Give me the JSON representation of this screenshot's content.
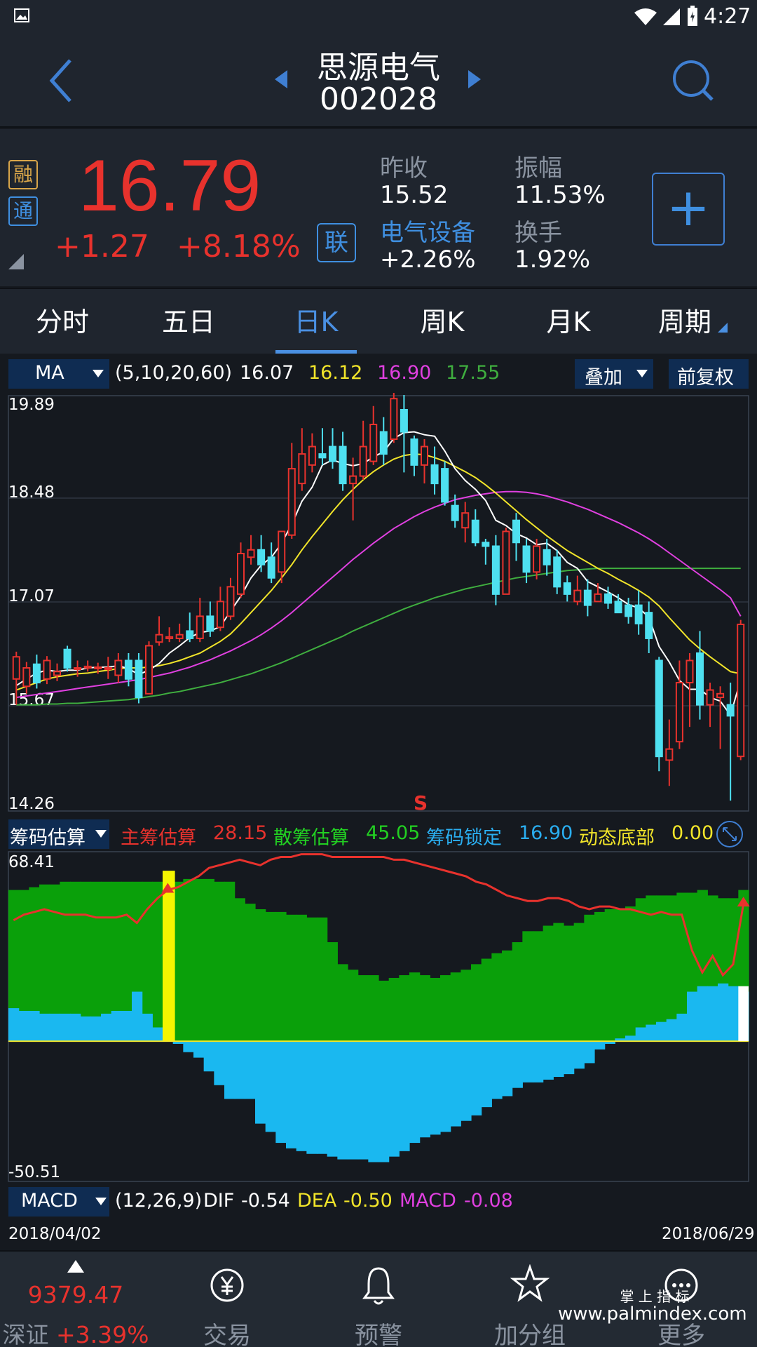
{
  "status": {
    "time": "4:27"
  },
  "header": {
    "name": "思源电气",
    "code": "002028"
  },
  "quote": {
    "badge_rong": "融",
    "badge_tong": "通",
    "price": "16.79",
    "change": "+1.27",
    "change_pct": "+8.18%",
    "link_label": "联",
    "prev_close_label": "昨收",
    "prev_close": "15.52",
    "amplitude_label": "振幅",
    "amplitude": "11.53%",
    "sector_label": "电气设备",
    "sector_change": "+2.26%",
    "turnover_label": "换手",
    "turnover": "1.92%",
    "add_label": "+"
  },
  "tabs": [
    "分时",
    "五日",
    "日K",
    "周K",
    "月K",
    "周期"
  ],
  "ma": {
    "selector": "MA",
    "params": "(5,10,20,60)",
    "v5": "16.07",
    "v10": "16.12",
    "v20": "16.90",
    "v60": "17.55",
    "overlay": "叠加",
    "fuquan": "前复权"
  },
  "price_axis": [
    "19.89",
    "18.48",
    "17.07",
    "15.67",
    "14.26"
  ],
  "sell_marker": "S",
  "chip": {
    "selector": "筹码估算",
    "main_label": "主筹估算",
    "main_value": "28.15",
    "retail_label": "散筹估算",
    "retail_value": "45.05",
    "lock_label": "筹码锁定",
    "lock_value": "16.90",
    "bottom_label": "动态底部",
    "bottom_value": "0.00",
    "axis_top": "68.41",
    "axis_bottom": "-50.51"
  },
  "macd": {
    "selector": "MACD",
    "params": "(12,26,9)",
    "dif_label": "DIF",
    "dif": "-0.54",
    "dea_label": "DEA",
    "dea": "-0.50",
    "macd_label": "MACD",
    "macd": "-0.08"
  },
  "dates": {
    "start": "2018/04/02",
    "end": "2018/06/29"
  },
  "index": {
    "value": "9379.47",
    "name": "深证",
    "change": "+3.39%"
  },
  "nav": [
    "交易",
    "预警",
    "加分组",
    "更多"
  ],
  "watermark": {
    "line1": "掌 上 指 标",
    "line2": "www.palmindex.com"
  },
  "colors": {
    "up": "#e8322d",
    "down": "#4ee0f0",
    "accent": "#4a90e2",
    "ma5": "#ffffff",
    "ma10": "#f2e52a",
    "ma20": "#e040e0",
    "ma60": "#3fae3f"
  },
  "chart_data": {
    "type": "candlestick",
    "ylim": [
      14.26,
      19.89
    ],
    "candles": [
      [
        16.05,
        16.35,
        16.42,
        15.7
      ],
      [
        15.95,
        16.2,
        16.28,
        15.85
      ],
      [
        16.25,
        16.0,
        16.38,
        15.92
      ],
      [
        16.05,
        16.3,
        16.36,
        15.98
      ],
      [
        16.1,
        16.15,
        16.26,
        16.02
      ],
      [
        16.45,
        16.2,
        16.5,
        16.15
      ],
      [
        16.2,
        16.2,
        16.3,
        16.08
      ],
      [
        16.2,
        16.22,
        16.3,
        16.15
      ],
      [
        16.2,
        16.21,
        16.27,
        16.12
      ],
      [
        16.2,
        16.2,
        16.35,
        16.05
      ],
      [
        16.1,
        16.3,
        16.4,
        16.0
      ],
      [
        16.3,
        16.05,
        16.4,
        15.95
      ],
      [
        16.3,
        15.8,
        16.4,
        15.72
      ],
      [
        15.85,
        16.5,
        16.56,
        15.85
      ],
      [
        16.55,
        16.65,
        16.9,
        16.5
      ],
      [
        16.6,
        16.62,
        16.75,
        16.55
      ],
      [
        16.6,
        16.65,
        16.8,
        16.55
      ],
      [
        16.7,
        16.6,
        16.95,
        16.55
      ],
      [
        16.6,
        16.9,
        17.15,
        16.55
      ],
      [
        16.9,
        16.7,
        17.1,
        16.62
      ],
      [
        16.75,
        17.1,
        17.3,
        16.7
      ],
      [
        16.9,
        17.3,
        17.42,
        16.85
      ],
      [
        17.2,
        17.75,
        17.9,
        17.15
      ],
      [
        17.7,
        17.8,
        18.0,
        17.6
      ],
      [
        17.8,
        17.6,
        18.0,
        17.5
      ],
      [
        17.7,
        17.42,
        17.9,
        17.35
      ],
      [
        17.5,
        18.05,
        18.05,
        17.35
      ],
      [
        18.0,
        18.9,
        19.25,
        17.95
      ],
      [
        18.7,
        19.1,
        19.45,
        18.6
      ],
      [
        18.95,
        19.2,
        19.38,
        18.85
      ],
      [
        19.1,
        19.05,
        19.45,
        18.95
      ],
      [
        19.2,
        19.0,
        19.45,
        18.9
      ],
      [
        19.2,
        18.7,
        19.4,
        18.6
      ],
      [
        18.7,
        18.8,
        19.05,
        18.2
      ],
      [
        18.8,
        19.2,
        19.55,
        18.75
      ],
      [
        19.0,
        19.5,
        19.75,
        18.95
      ],
      [
        19.4,
        19.1,
        19.6,
        18.95
      ],
      [
        19.3,
        19.85,
        19.95,
        19.25
      ],
      [
        19.7,
        19.4,
        19.9,
        18.85
      ],
      [
        19.3,
        18.95,
        19.35,
        18.8
      ],
      [
        18.95,
        19.2,
        19.3,
        18.7
      ],
      [
        18.95,
        18.7,
        19.2,
        18.55
      ],
      [
        18.9,
        18.45,
        19.0,
        18.4
      ],
      [
        18.4,
        18.2,
        18.55,
        18.1
      ],
      [
        18.1,
        18.3,
        18.45,
        17.9
      ],
      [
        18.2,
        17.9,
        18.35,
        17.85
      ],
      [
        17.9,
        17.85,
        17.95,
        17.6
      ],
      [
        17.85,
        17.2,
        18.0,
        17.05
      ],
      [
        17.2,
        18.05,
        18.1,
        17.2
      ],
      [
        18.2,
        17.9,
        18.3,
        17.65
      ],
      [
        17.85,
        17.5,
        17.95,
        17.35
      ],
      [
        17.5,
        17.85,
        17.95,
        17.4
      ],
      [
        17.8,
        17.6,
        17.95,
        17.45
      ],
      [
        17.7,
        17.3,
        17.8,
        17.2
      ],
      [
        17.35,
        17.2,
        17.45,
        17.1
      ],
      [
        17.1,
        17.25,
        17.45,
        17.05
      ],
      [
        17.25,
        17.05,
        17.4,
        16.9
      ],
      [
        17.1,
        17.2,
        17.35,
        17.1
      ],
      [
        17.2,
        17.08,
        17.3,
        17.0
      ],
      [
        17.1,
        16.95,
        17.2,
        16.95
      ],
      [
        17.05,
        16.9,
        17.15,
        16.8
      ],
      [
        17.05,
        16.8,
        17.25,
        16.65
      ],
      [
        16.95,
        16.6,
        17.1,
        16.4
      ],
      [
        16.3,
        15.0,
        16.35,
        14.8
      ],
      [
        14.95,
        15.1,
        15.5,
        14.6
      ],
      [
        15.2,
        16.0,
        16.3,
        15.1
      ],
      [
        16.0,
        16.3,
        16.4,
        15.4
      ],
      [
        16.4,
        15.7,
        16.7,
        15.5
      ],
      [
        15.7,
        15.9,
        16.0,
        15.4
      ],
      [
        15.8,
        15.85,
        15.95,
        15.1
      ],
      [
        15.7,
        15.55,
        16.0,
        14.4
      ],
      [
        15.0,
        16.79,
        16.85,
        14.95
      ]
    ],
    "ma5": [
      15.96,
      16.05,
      16.13,
      16.17,
      16.15,
      16.17,
      16.17,
      16.2,
      16.21,
      16.21,
      16.23,
      16.19,
      16.11,
      16.17,
      16.26,
      16.4,
      16.5,
      16.61,
      16.68,
      16.7,
      16.76,
      16.97,
      17.17,
      17.42,
      17.59,
      17.7,
      17.89,
      18.15,
      18.46,
      18.65,
      18.95,
      19.02,
      18.97,
      18.94,
      18.97,
      19.06,
      19.13,
      19.31,
      19.39,
      19.4,
      19.36,
      19.34,
      19.14,
      18.9,
      18.74,
      18.62,
      18.47,
      18.2,
      18.13,
      18.02,
      17.96,
      17.87,
      17.89,
      17.79,
      17.63,
      17.55,
      17.37,
      17.3,
      17.23,
      17.15,
      17.06,
      17.01,
      16.89,
      16.49,
      16.28,
      16.03,
      15.91,
      15.91,
      15.8,
      15.75,
      15.56,
      16.04
    ],
    "ma10": [
      15.9,
      15.95,
      16.0,
      16.05,
      16.08,
      16.1,
      16.12,
      16.13,
      16.15,
      16.17,
      16.19,
      16.2,
      16.2,
      16.21,
      16.23,
      16.26,
      16.3,
      16.35,
      16.4,
      16.48,
      16.56,
      16.66,
      16.8,
      16.95,
      17.1,
      17.25,
      17.42,
      17.6,
      17.8,
      17.98,
      18.15,
      18.32,
      18.48,
      18.62,
      18.75,
      18.86,
      18.95,
      19.03,
      19.08,
      19.1,
      19.09,
      19.05,
      19.0,
      18.93,
      18.86,
      18.78,
      18.68,
      18.57,
      18.45,
      18.33,
      18.21,
      18.1,
      17.99,
      17.89,
      17.79,
      17.71,
      17.63,
      17.55,
      17.48,
      17.4,
      17.33,
      17.25,
      17.16,
      17.04,
      16.88,
      16.73,
      16.58,
      16.46,
      16.35,
      16.25,
      16.15,
      16.12
    ],
    "ma20": [
      15.8,
      15.82,
      15.84,
      15.86,
      15.88,
      15.9,
      15.92,
      15.94,
      15.96,
      15.98,
      16.0,
      16.02,
      16.04,
      16.07,
      16.1,
      16.13,
      16.17,
      16.21,
      16.26,
      16.31,
      16.37,
      16.43,
      16.5,
      16.57,
      16.65,
      16.74,
      16.84,
      16.95,
      17.07,
      17.19,
      17.31,
      17.43,
      17.55,
      17.67,
      17.78,
      17.89,
      17.99,
      18.09,
      18.17,
      18.25,
      18.32,
      18.38,
      18.43,
      18.48,
      18.51,
      18.54,
      18.56,
      18.58,
      18.59,
      18.59,
      18.58,
      18.56,
      18.53,
      18.49,
      18.45,
      18.4,
      18.35,
      18.29,
      18.23,
      18.17,
      18.1,
      18.03,
      17.95,
      17.86,
      17.76,
      17.66,
      17.56,
      17.46,
      17.36,
      17.26,
      17.15,
      16.9
    ],
    "ma60": [
      15.7,
      15.7,
      15.7,
      15.71,
      15.71,
      15.72,
      15.72,
      15.73,
      15.74,
      15.75,
      15.76,
      15.77,
      15.79,
      15.81,
      15.83,
      15.86,
      15.88,
      15.91,
      15.94,
      15.97,
      16.0,
      16.04,
      16.08,
      16.12,
      16.17,
      16.22,
      16.27,
      16.33,
      16.39,
      16.45,
      16.51,
      16.57,
      16.63,
      16.7,
      16.76,
      16.82,
      16.88,
      16.94,
      17.0,
      17.05,
      17.1,
      17.15,
      17.19,
      17.23,
      17.27,
      17.3,
      17.33,
      17.36,
      17.39,
      17.42,
      17.44,
      17.46,
      17.48,
      17.5,
      17.52,
      17.53,
      17.54,
      17.55,
      17.55,
      17.55,
      17.55,
      17.55,
      17.55,
      17.55,
      17.55,
      17.55,
      17.55,
      17.55,
      17.55,
      17.55,
      17.55,
      17.55
    ],
    "chip_retail": [
      55,
      55,
      56,
      57,
      57,
      58,
      58,
      58,
      58,
      58,
      58,
      58,
      58,
      58,
      58,
      58,
      58,
      59,
      59,
      59,
      58,
      58,
      52,
      50,
      48,
      47,
      47,
      46,
      46,
      45,
      45,
      36,
      28,
      26,
      24,
      24,
      22,
      23,
      24,
      25,
      24,
      23,
      24,
      25,
      26,
      28,
      30,
      32,
      33,
      36,
      40,
      40,
      42,
      43,
      42,
      43,
      46,
      47,
      48,
      48,
      49,
      52,
      53,
      53,
      53,
      54,
      54,
      55,
      53,
      52,
      52,
      55
    ],
    "chip_main": [
      44,
      46,
      47,
      48,
      47,
      46,
      46,
      46,
      45,
      45,
      45,
      46,
      43,
      48,
      52,
      55,
      56,
      58,
      60,
      63,
      64,
      65,
      66,
      65,
      64,
      66,
      67,
      67,
      68,
      68,
      68,
      67,
      67,
      67,
      67,
      67,
      67,
      66,
      66,
      65,
      64,
      63,
      62,
      61,
      60,
      58,
      57,
      55,
      53,
      52,
      51,
      51,
      52,
      52,
      51,
      49,
      48,
      49,
      49,
      48,
      48,
      47,
      46,
      47,
      46,
      46,
      33,
      25,
      31,
      24,
      28,
      50
    ],
    "chip_lock": [
      12,
      11,
      11,
      10,
      10,
      10,
      10,
      9,
      9,
      10,
      11,
      11,
      18,
      10,
      5,
      0,
      0,
      0,
      0,
      0,
      0,
      0,
      0,
      0,
      0,
      0,
      0,
      0,
      0,
      0,
      0,
      0,
      0,
      0,
      0,
      0,
      0,
      0,
      0,
      0,
      0,
      0,
      0,
      0,
      0,
      0,
      0,
      0,
      0,
      0,
      0,
      0,
      0,
      0,
      0,
      0,
      0,
      0,
      0,
      1,
      2,
      5,
      6,
      7,
      8,
      10,
      18,
      20,
      20,
      21,
      20,
      18
    ],
    "chip_minus": [
      0,
      0,
      0,
      0,
      0,
      0,
      0,
      0,
      0,
      0,
      0,
      0,
      0,
      0,
      0,
      0,
      -1,
      -4,
      -6,
      -11,
      -16,
      -21,
      -21,
      -21,
      -30,
      -33,
      -37,
      -39,
      -40,
      -41,
      -41,
      -42,
      -43,
      -43,
      -43,
      -44,
      -44,
      -42,
      -40,
      -37,
      -35,
      -34,
      -33,
      -31,
      -29,
      -27,
      -24,
      -21,
      -20,
      -17,
      -15,
      -15,
      -14,
      -13,
      -12,
      -10,
      -8,
      -3,
      -1,
      0,
      0,
      0,
      0,
      0,
      0,
      0,
      0,
      0,
      0,
      0,
      0,
      0
    ],
    "chip_ylim": [
      -50.51,
      68.41
    ],
    "yellow_bar_index": 15
  }
}
